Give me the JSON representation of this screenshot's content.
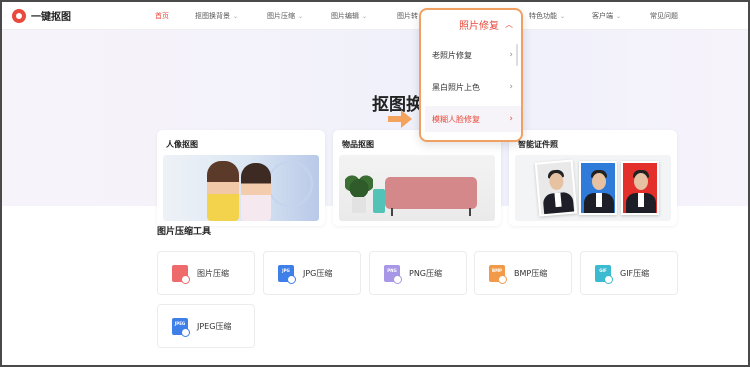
{
  "brand": {
    "name": "一键抠图",
    "accent": "#e84a3c"
  },
  "nav": {
    "items": [
      {
        "label": "首页",
        "active": true,
        "caret": false
      },
      {
        "label": "抠图换背景",
        "active": false,
        "caret": true
      },
      {
        "label": "图片压缩",
        "active": false,
        "caret": true
      },
      {
        "label": "图片编辑",
        "active": false,
        "caret": true
      },
      {
        "label": "图片转",
        "active": false,
        "caret": false
      },
      {
        "label": "特色功能",
        "active": false,
        "caret": true
      },
      {
        "label": "客户端",
        "active": false,
        "caret": true
      },
      {
        "label": "常见问题",
        "active": false,
        "caret": false
      }
    ]
  },
  "dropdown": {
    "title": "照片修复",
    "items": [
      {
        "label": "老照片修复",
        "active": false
      },
      {
        "label": "黑白照片上色",
        "active": false
      },
      {
        "label": "模糊人脸修复",
        "active": true
      }
    ],
    "border_color": "#f0a063"
  },
  "hero": {
    "title": "抠图换",
    "cards": [
      {
        "title": "人像抠图"
      },
      {
        "title": "物品抠图"
      },
      {
        "title": "智能证件照"
      }
    ]
  },
  "compress": {
    "title": "图片压缩工具",
    "tools": [
      {
        "label": "图片压缩",
        "icon": "image-compress-icon",
        "icon_text": "",
        "color": "#ef6a6a"
      },
      {
        "label": "JPG压缩",
        "icon": "jpg-file-icon",
        "icon_text": "JPG",
        "color": "#3f7fe8"
      },
      {
        "label": "PNG压缩",
        "icon": "png-file-icon",
        "icon_text": "PNG",
        "color": "#a896e6"
      },
      {
        "label": "BMP压缩",
        "icon": "bmp-file-icon",
        "icon_text": "BMP",
        "color": "#f19b4a"
      },
      {
        "label": "GIF压缩",
        "icon": "gif-file-icon",
        "icon_text": "GIF",
        "color": "#3bbad0"
      },
      {
        "label": "JPEG压缩",
        "icon": "jpeg-file-icon",
        "icon_text": "JPEG",
        "color": "#3f7fe8"
      }
    ]
  }
}
